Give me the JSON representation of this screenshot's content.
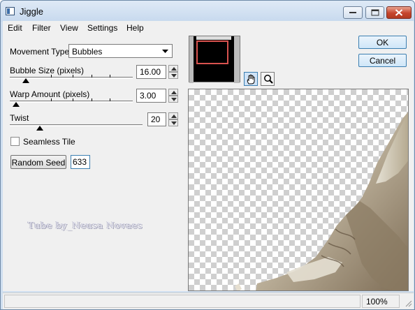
{
  "window": {
    "title": "Jiggle"
  },
  "menu": [
    "Edit",
    "Filter",
    "View",
    "Settings",
    "Help"
  ],
  "controls": {
    "movement_type": {
      "label": "Movement Type:",
      "value": "Bubbles"
    },
    "bubble_size": {
      "label": "Bubble Size (pixels)",
      "value": "16.00"
    },
    "warp_amount": {
      "label": "Warp Amount (pixels)",
      "value": "3.00"
    },
    "twist": {
      "label": "Twist",
      "value": "20"
    },
    "seamless_tile": {
      "label": "Seamless Tile",
      "checked": false
    },
    "random_seed": {
      "button_label": "Random Seed",
      "value": "633"
    }
  },
  "watermark": "Tube by_Neusa Novaes",
  "buttons": {
    "ok": "OK",
    "cancel": "Cancel"
  },
  "tools": [
    "hand-tool-icon",
    "zoom-tool-icon"
  ],
  "status": {
    "zoom": "100%"
  }
}
